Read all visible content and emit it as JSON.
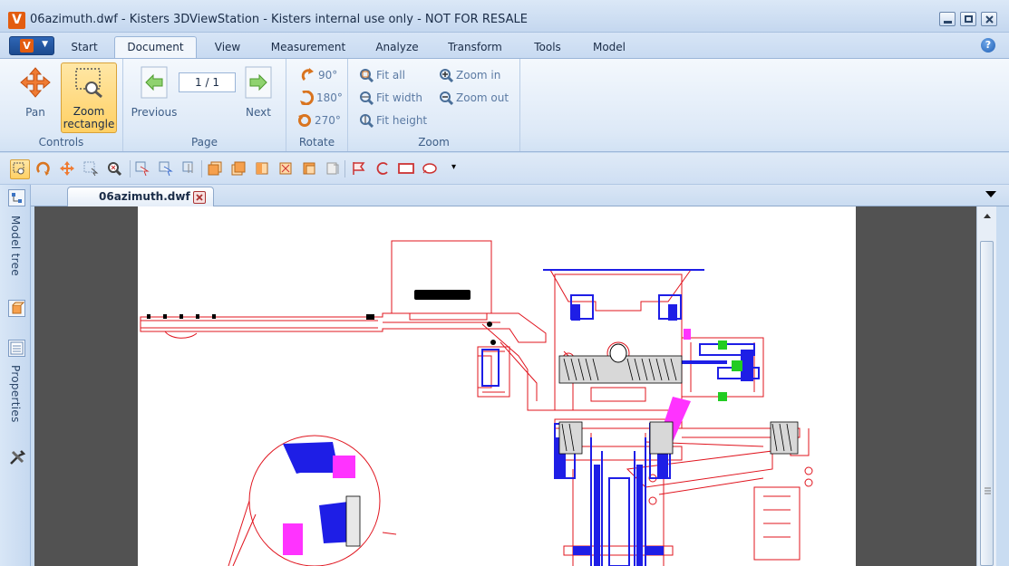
{
  "window": {
    "logo": "V",
    "title": "06azimuth.dwf - Kisters 3DViewStation - Kisters internal use only - NOT FOR RESALE"
  },
  "menu": {
    "app_logo": "V",
    "tabs": [
      {
        "label": "Start"
      },
      {
        "label": "Document"
      },
      {
        "label": "View"
      },
      {
        "label": "Measurement"
      },
      {
        "label": "Analyze"
      },
      {
        "label": "Transform"
      },
      {
        "label": "Tools"
      },
      {
        "label": "Model"
      }
    ],
    "active_tab": "Document",
    "help": "?"
  },
  "ribbon": {
    "controls": {
      "label": "Controls",
      "pan": "Pan",
      "zoom_rect_1": "Zoom",
      "zoom_rect_2": "rectangle"
    },
    "page": {
      "label": "Page",
      "previous": "Previous",
      "next": "Next",
      "current": "1 / 1"
    },
    "rotate": {
      "label": "Rotate",
      "r90": "90°",
      "r180": "180°",
      "r270": "270°"
    },
    "zoom": {
      "label": "Zoom",
      "fit_all": "Fit all",
      "fit_width": "Fit width",
      "fit_height": "Fit height",
      "zoom_in": "Zoom in",
      "zoom_out": "Zoom out"
    }
  },
  "side_panel": {
    "model_tree": "Model tree",
    "properties": "Properties"
  },
  "document": {
    "tab_label": "06azimuth.dwf"
  },
  "colors": {
    "accent": "#e35c0f",
    "drawing_red": "#e0141e",
    "drawing_blue": "#1e1ee6",
    "drawing_magenta": "#ff33ff",
    "drawing_green": "#22cc22"
  }
}
